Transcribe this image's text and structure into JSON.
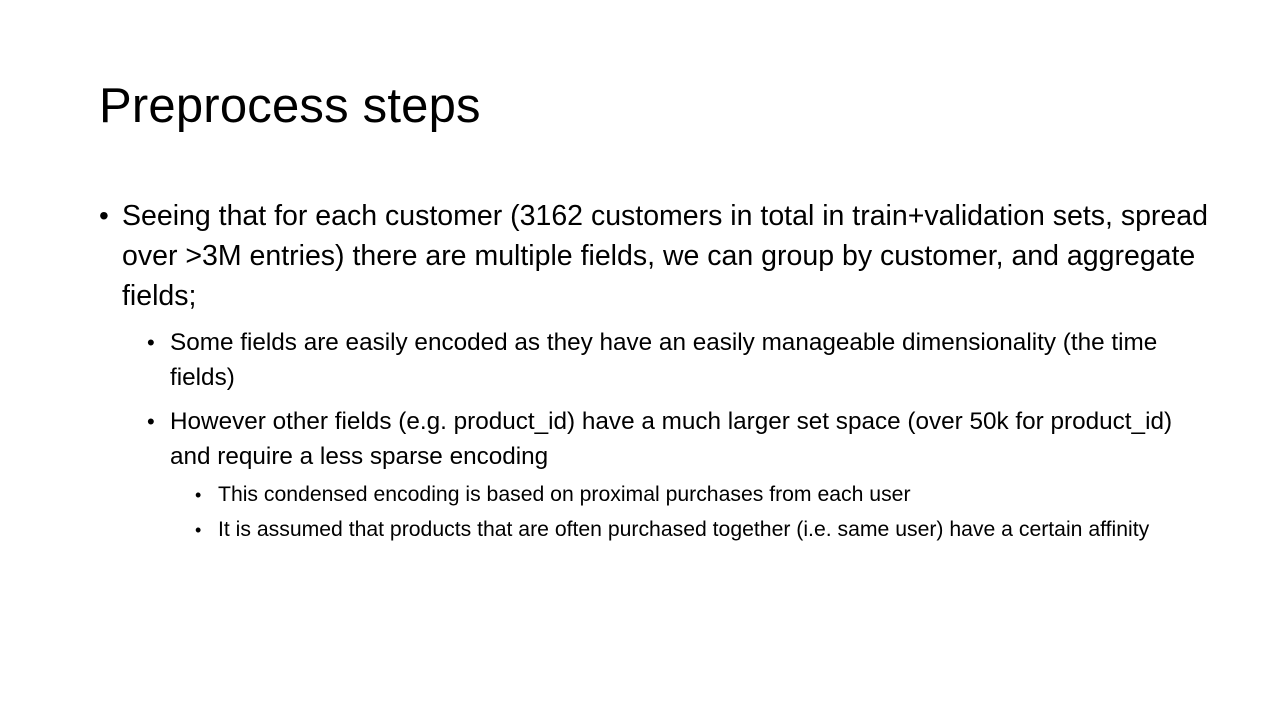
{
  "slide": {
    "title": "Preprocess steps",
    "bullets": [
      {
        "text": "Seeing that for each customer (3162 customers in total in train+validation sets, spread over >3M entries) there are multiple fields, we can group by customer, and aggregate fields;",
        "children": [
          {
            "text": "Some fields are easily encoded as they have an easily manageable dimensionality (the time fields)"
          },
          {
            "text": "However other fields (e.g. product_id) have a much larger set space (over 50k for product_id) and require a less sparse encoding",
            "children": [
              {
                "text": "This condensed encoding is based on proximal purchases from each user"
              },
              {
                "text": "It is assumed that products that are often purchased together (i.e. same user) have a certain affinity"
              }
            ]
          }
        ]
      }
    ],
    "bullet_symbol": "•"
  }
}
